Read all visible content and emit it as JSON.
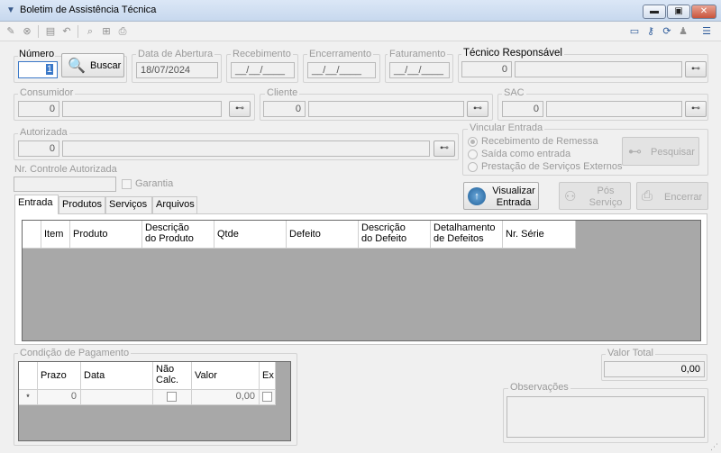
{
  "window": {
    "title": "Boletim de Assistência Técnica"
  },
  "header": {
    "numero_label": "Número",
    "numero_value": "1",
    "buscar_label": "Buscar",
    "data_abertura_label": "Data de Abertura",
    "data_abertura_value": "18/07/2024",
    "recebimento_label": "Recebimento",
    "recebimento_value": "__/__/____",
    "encerramento_label": "Encerramento",
    "encerramento_value": "__/__/____",
    "faturamento_label": "Faturamento",
    "faturamento_value": "__/__/____",
    "tecnico_label": "Técnico Responsável",
    "tecnico_code": "0"
  },
  "parties": {
    "consumidor_label": "Consumidor",
    "consumidor_code": "0",
    "cliente_label": "Cliente",
    "cliente_code": "0",
    "sac_label": "SAC",
    "sac_code": "0",
    "autorizada_label": "Autorizada",
    "autorizada_code": "0",
    "nr_controle_label": "Nr. Controle Autorizada",
    "garantia_label": "Garantia"
  },
  "vincular": {
    "label": "Vincular Entrada",
    "options": [
      "Recebimento de Remessa",
      "Saída como entrada",
      "Prestação de Serviços Externos"
    ],
    "pesquisar_label": "Pesquisar"
  },
  "actions": {
    "visualizar_line1": "Visualizar",
    "visualizar_line2": "Entrada",
    "pos_line1": "Pós",
    "pos_line2": "Serviço",
    "encerrar_label": "Encerrar"
  },
  "tabs": [
    "Entrada",
    "Produtos",
    "Serviços",
    "Arquivos"
  ],
  "entrada_grid": {
    "columns": [
      {
        "l1": "Item",
        "l2": ""
      },
      {
        "l1": "Produto",
        "l2": ""
      },
      {
        "l1": "Descrição",
        "l2": "do Produto"
      },
      {
        "l1": "Qtde",
        "l2": ""
      },
      {
        "l1": "Defeito",
        "l2": ""
      },
      {
        "l1": "Descrição",
        "l2": "do Defeito"
      },
      {
        "l1": "Detalhamento",
        "l2": "de Defeitos"
      },
      {
        "l1": "Nr. Série",
        "l2": ""
      }
    ]
  },
  "pagamento": {
    "label": "Condição de Pagamento",
    "columns": [
      {
        "l1": "Prazo",
        "l2": ""
      },
      {
        "l1": "Data",
        "l2": ""
      },
      {
        "l1": "Não",
        "l2": "Calc."
      },
      {
        "l1": "Valor",
        "l2": ""
      },
      {
        "l1": "Ex",
        "l2": ""
      }
    ],
    "row_marker": "*",
    "row_prazo": "0",
    "row_valor": "0,00"
  },
  "totals": {
    "valor_total_label": "Valor Total",
    "valor_total_value": "0,00",
    "observacoes_label": "Observações"
  }
}
